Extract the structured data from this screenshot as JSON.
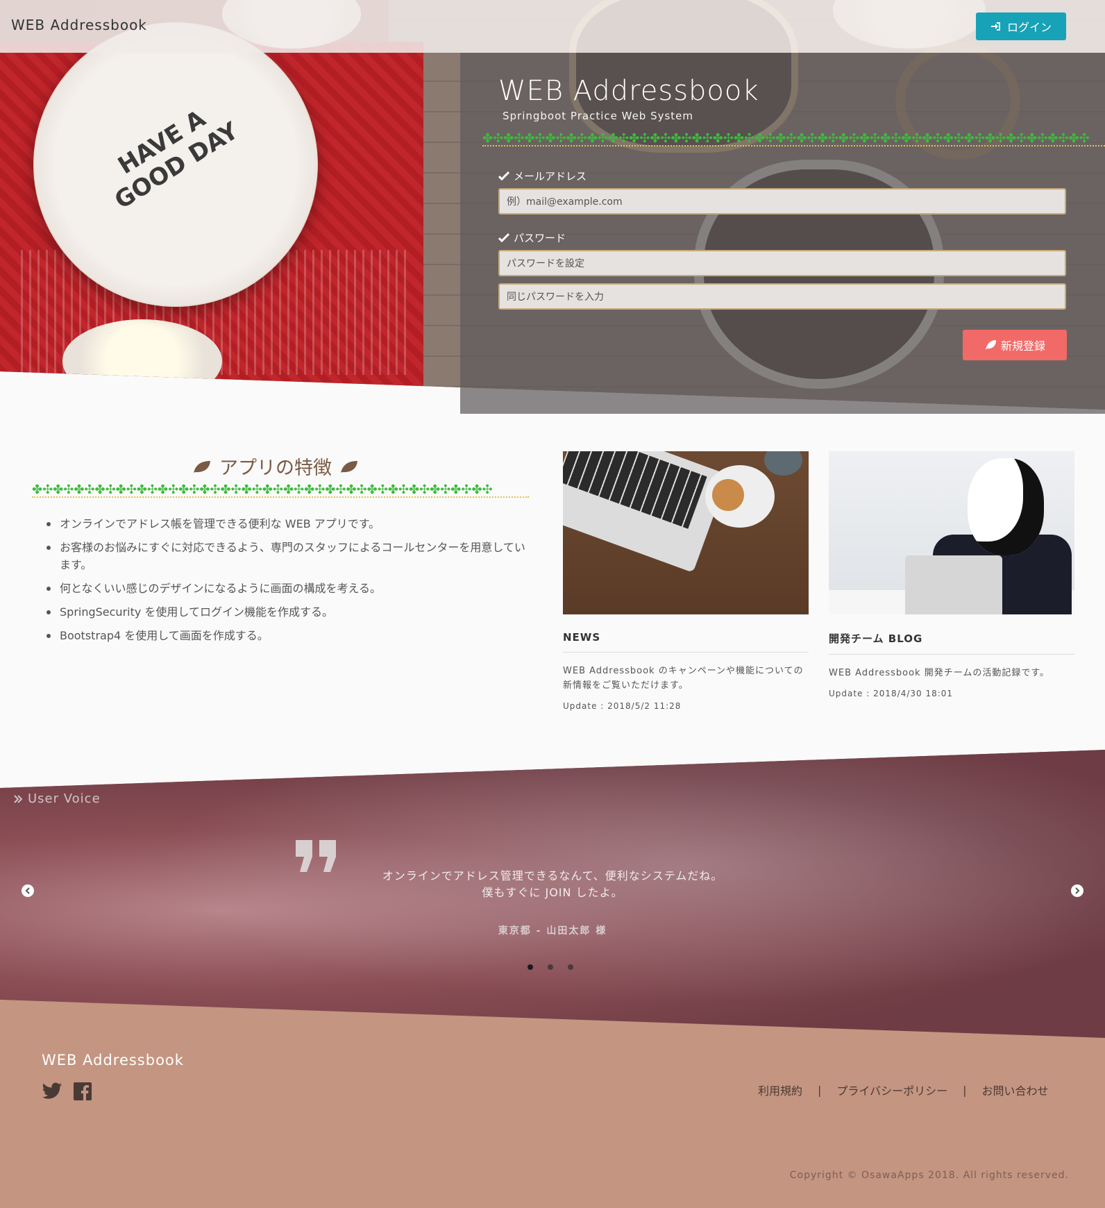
{
  "colors": {
    "login_button": "#17a2b8",
    "signup_button": "#f26a68",
    "footer_bg": "#c49581",
    "heading_brown": "#7a5a45",
    "clover_green": "#3dbb3d"
  },
  "navbar": {
    "brand": "WEB Addressbook",
    "login_label": "ログイン"
  },
  "hero": {
    "title": "WEB Addressbook",
    "subtitle": "Springboot Practice Web System",
    "email_label": "メールアドレス",
    "email_placeholder": "例）mail@example.com",
    "password_label": "パスワード",
    "password_placeholder": "パスワードを設定",
    "password_confirm_placeholder": "同じパスワードを入力",
    "signup_label": "新規登録",
    "plate_text_line1": "HAVE A",
    "plate_text_line2": "GOOD DAY"
  },
  "features": {
    "title": "アプリの特徴",
    "items": [
      "オンラインでアドレス帳を管理できる便利な WEB アプリです。",
      "お客様のお悩みにすぐに対応できるよう、専門のスタッフによるコールセンターを用意しています。",
      "何となくいい感じのデザインになるように画面の構成を考える。",
      "SpringSecurity を使用してログイン機能を作成する。",
      "Bootstrap4 を使用して画面を作成する。"
    ]
  },
  "cards": [
    {
      "title": "NEWS",
      "text": "WEB Addressbook のキャンペーンや機能についての新情報をご覧いただけます。",
      "date": "Update : 2018/5/2 11:28"
    },
    {
      "title": "開発チーム BLOG",
      "text": "WEB Addressbook 開発チームの活動記録です。",
      "date": "Update : 2018/4/30 18:01"
    }
  ],
  "voice": {
    "label": "User Voice",
    "quote_line1": "オンラインでアドレス管理できるなんて、便利なシステムだね。",
    "quote_line2": "僕もすぐに JOIN したよ。",
    "author": "東京都 - 山田太郎 様",
    "active_slide": 1,
    "slide_count": 3
  },
  "footer": {
    "brand": "WEB Addressbook",
    "links": [
      "利用規約",
      "プライバシーポリシー",
      "お問い合わせ"
    ],
    "separator": "|",
    "copyright": "Copyright © OsawaApps 2018. All rights reserved."
  }
}
